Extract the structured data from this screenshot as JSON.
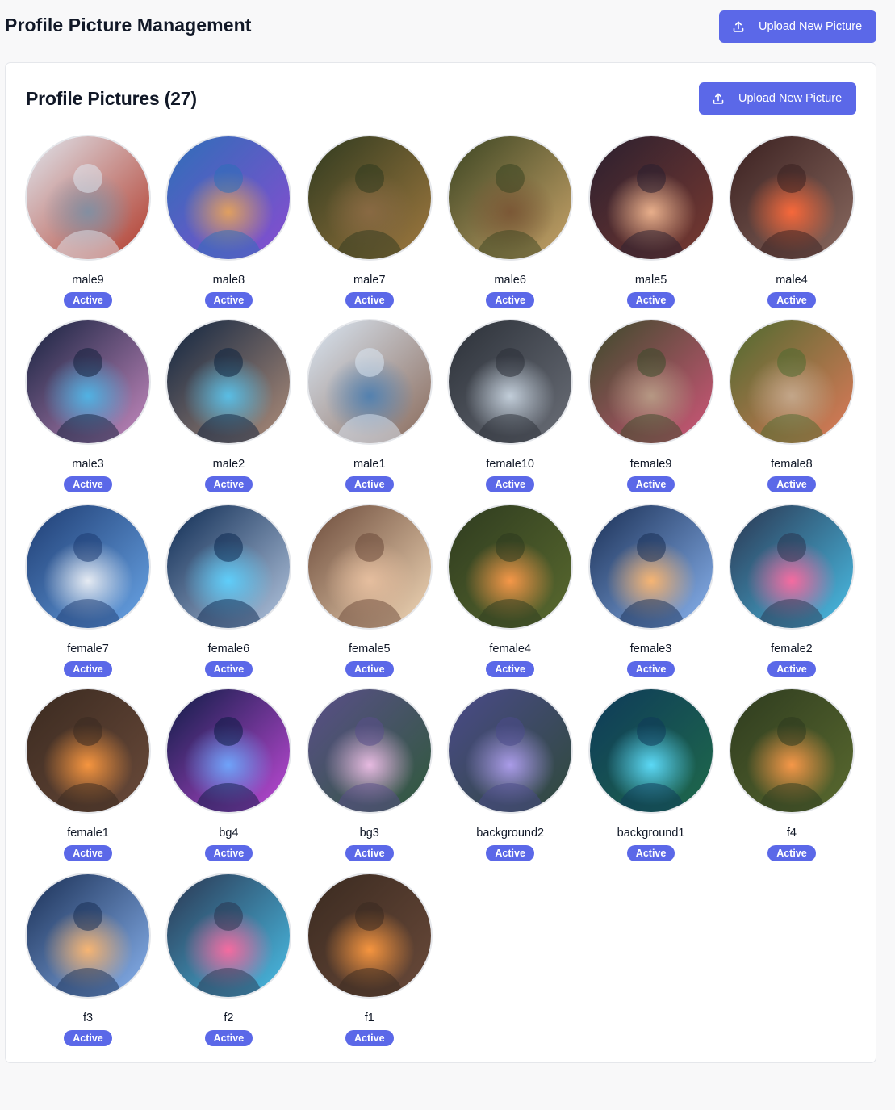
{
  "header": {
    "title": "Profile Picture Management",
    "upload_label": "Upload New Picture",
    "upload_icon": "upload-icon"
  },
  "panel": {
    "title": "Profile Pictures (27)",
    "upload_label": "Upload New Picture"
  },
  "colors": {
    "accent": "#5b68e8",
    "page_bg": "#f8f8f9",
    "panel_bg": "#ffffff"
  },
  "pictures": [
    {
      "name": "male9",
      "status": "Active",
      "palette": [
        "#dfe6ee",
        "#7f8fa3",
        "#b23a2a"
      ]
    },
    {
      "name": "male8",
      "status": "Active",
      "palette": [
        "#2d6fb8",
        "#e7a35a",
        "#8a4bd1"
      ]
    },
    {
      "name": "male7",
      "status": "Active",
      "palette": [
        "#2f3a1f",
        "#8a6a44",
        "#a0793f"
      ]
    },
    {
      "name": "male6",
      "status": "Active",
      "palette": [
        "#3b4522",
        "#7a5635",
        "#c9a46a"
      ]
    },
    {
      "name": "male5",
      "status": "Active",
      "palette": [
        "#2a1f2f",
        "#f0b690",
        "#7a3a30"
      ]
    },
    {
      "name": "male4",
      "status": "Active",
      "palette": [
        "#3a2020",
        "#ff6a3a",
        "#8a6a60"
      ]
    },
    {
      "name": "male3",
      "status": "Active",
      "palette": [
        "#14213e",
        "#4fb7e8",
        "#c78ac0"
      ]
    },
    {
      "name": "male2",
      "status": "Active",
      "palette": [
        "#0f2440",
        "#59c3ec",
        "#b08e7a"
      ]
    },
    {
      "name": "male1",
      "status": "Active",
      "palette": [
        "#d9e6f3",
        "#4e7fb0",
        "#8a6a5a"
      ]
    },
    {
      "name": "female10",
      "status": "Active",
      "palette": [
        "#2b3038",
        "#c8d4e0",
        "#6b6f78"
      ]
    },
    {
      "name": "female9",
      "status": "Active",
      "palette": [
        "#3b4a2a",
        "#b89c86",
        "#d1567a"
      ]
    },
    {
      "name": "female8",
      "status": "Active",
      "palette": [
        "#4e6a2f",
        "#c5a98d",
        "#e07a5a"
      ]
    },
    {
      "name": "female7",
      "status": "Active",
      "palette": [
        "#1e3c72",
        "#eef1f6",
        "#6aa6e8"
      ]
    },
    {
      "name": "female6",
      "status": "Active",
      "palette": [
        "#0d2a52",
        "#5ed2ff",
        "#b5c7e0"
      ]
    },
    {
      "name": "female5",
      "status": "Active",
      "palette": [
        "#6b4a3a",
        "#e8c0a0",
        "#f3d9b8"
      ]
    },
    {
      "name": "female4",
      "status": "Active",
      "palette": [
        "#2e3b1f",
        "#ff9b4a",
        "#5a6a2f"
      ]
    },
    {
      "name": "female3",
      "status": "Active",
      "palette": [
        "#1a2f55",
        "#ffb870",
        "#8ab4f0"
      ]
    },
    {
      "name": "female2",
      "status": "Active",
      "palette": [
        "#2a3550",
        "#ff6aa0",
        "#4ac0e8"
      ]
    },
    {
      "name": "female1",
      "status": "Active",
      "palette": [
        "#3a2a20",
        "#ff9a40",
        "#6a4a3a"
      ]
    },
    {
      "name": "bg4",
      "status": "Active",
      "palette": [
        "#0d1c45",
        "#6fa9ff",
        "#c14ad8"
      ]
    },
    {
      "name": "bg3",
      "status": "Active",
      "palette": [
        "#5a4e8a",
        "#f0c0e8",
        "#2f5a3a"
      ]
    },
    {
      "name": "background2",
      "status": "Active",
      "palette": [
        "#4a4a8a",
        "#b0a0f0",
        "#2f4a3a"
      ]
    },
    {
      "name": "background1",
      "status": "Active",
      "palette": [
        "#0e3a5a",
        "#5fe0ff",
        "#1f6a4a"
      ]
    },
    {
      "name": "f4",
      "status": "Active",
      "palette": [
        "#2e3b1f",
        "#ff9b4a",
        "#5a6a2f"
      ]
    },
    {
      "name": "f3",
      "status": "Active",
      "palette": [
        "#1a2f55",
        "#ffb870",
        "#8ab4f0"
      ]
    },
    {
      "name": "f2",
      "status": "Active",
      "palette": [
        "#2a3550",
        "#ff6aa0",
        "#4ac0e8"
      ]
    },
    {
      "name": "f1",
      "status": "Active",
      "palette": [
        "#3a2a20",
        "#ff9a40",
        "#6a4a3a"
      ]
    }
  ]
}
